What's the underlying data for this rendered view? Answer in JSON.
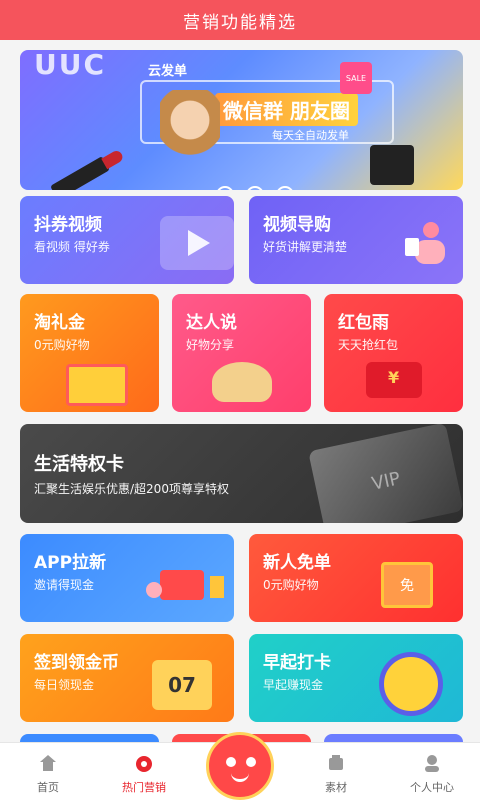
{
  "header": {
    "title": "营销功能精选"
  },
  "banner": {
    "brand": "云发单",
    "main": "微信群 朋友圈",
    "sub": "每天全自动发单",
    "sale": "SALE",
    "uuc": "UUC"
  },
  "cards": {
    "dq": {
      "title": "抖券视频",
      "sub": "看视频 得好券"
    },
    "spdg": {
      "title": "视频导购",
      "sub": "好货讲解更清楚"
    },
    "tlj": {
      "title": "淘礼金",
      "sub": "0元购好物"
    },
    "drs": {
      "title": "达人说",
      "sub": "好物分享"
    },
    "hby": {
      "title": "红包雨",
      "sub": "天天抢红包"
    },
    "shtq": {
      "title": "生活特权卡",
      "sub": "汇聚生活娱乐优惠/超200项尊享特权",
      "vip": "VIP"
    },
    "app": {
      "title": "APP拉新",
      "sub": "邀请得现金"
    },
    "xr": {
      "title": "新人免单",
      "sub": "0元购好物",
      "badge": "免"
    },
    "qd": {
      "title": "签到领金币",
      "sub": "每日领现金",
      "digits": "07"
    },
    "zq": {
      "title": "早起打卡",
      "sub": "早起赚现金"
    }
  },
  "tabbar": [
    {
      "label": "首页",
      "icon": "home-icon"
    },
    {
      "label": "热门营销",
      "icon": "hot-marketing-icon"
    },
    {
      "label": "",
      "icon": "mascot-icon"
    },
    {
      "label": "素材",
      "icon": "material-icon"
    },
    {
      "label": "个人中心",
      "icon": "profile-icon"
    }
  ]
}
